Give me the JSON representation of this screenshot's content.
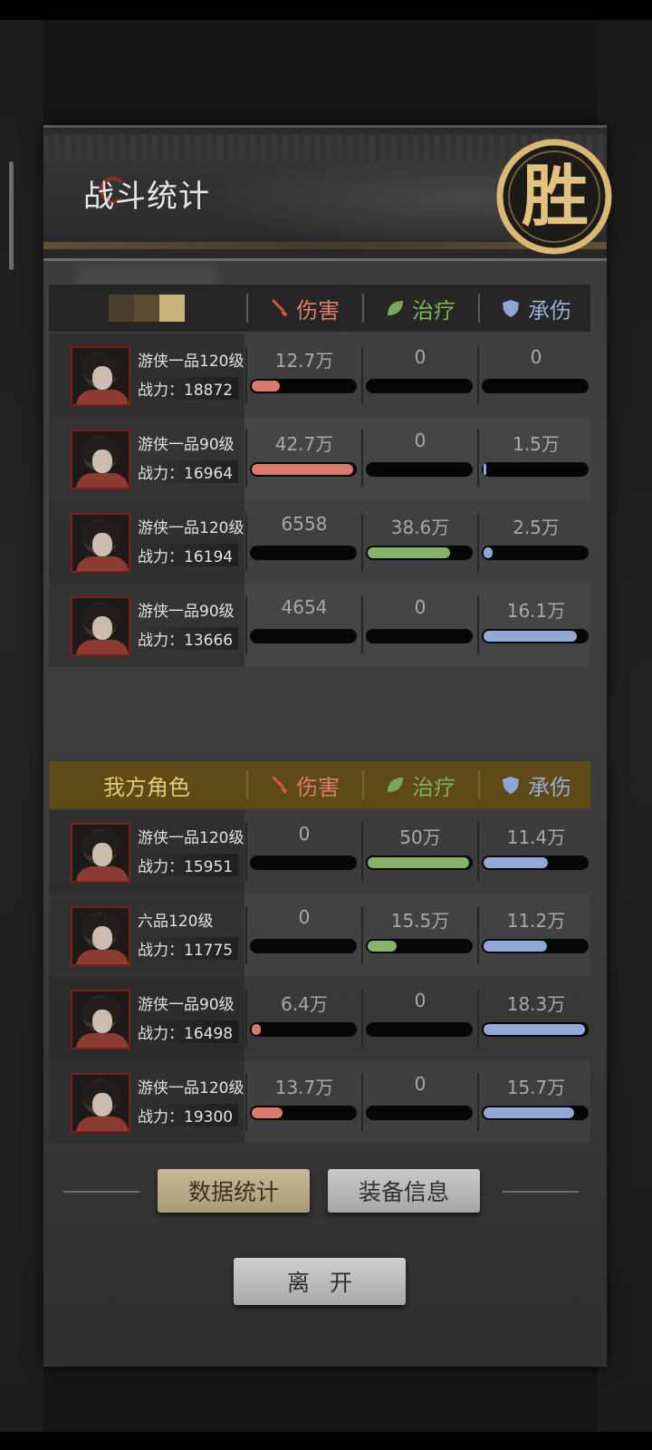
{
  "window": {
    "title": "战斗统计",
    "result_badge": "胜"
  },
  "colors": {
    "damage": "#d97a6c",
    "heal": "#86b26a",
    "tank": "#92a8d6",
    "ally_header": "#5d4a17",
    "badge_gold": "#d8b873"
  },
  "columns": {
    "damage": "伤害",
    "heal": "治疗",
    "tank": "承伤"
  },
  "enemy": {
    "rows": [
      {
        "rank": "游侠一品120级",
        "power": "战力：18872",
        "damage": "12.7万",
        "heal": "0",
        "tank": "0",
        "damage_fill": 0.27,
        "heal_fill": 0,
        "tank_fill": 0
      },
      {
        "rank": "游侠一品90级",
        "power": "战力：16964",
        "damage": "42.7万",
        "heal": "0",
        "tank": "1.5万",
        "damage_fill": 0.98,
        "heal_fill": 0,
        "tank_fill": 0.03
      },
      {
        "rank": "游侠一品120级",
        "power": "战力：16194",
        "damage": "6558",
        "heal": "38.6万",
        "tank": "2.5万",
        "damage_fill": 0,
        "heal_fill": 0.8,
        "tank_fill": 0.09
      },
      {
        "rank": "游侠一品90级",
        "power": "战力：13666",
        "damage": "4654",
        "heal": "0",
        "tank": "16.1万",
        "damage_fill": 0,
        "heal_fill": 0,
        "tank_fill": 0.9
      }
    ]
  },
  "ally": {
    "label": "我方角色",
    "rows": [
      {
        "rank": "游侠一品120级",
        "power": "战力：15951",
        "damage": "0",
        "heal": "50万",
        "tank": "11.4万",
        "damage_fill": 0,
        "heal_fill": 0.98,
        "tank_fill": 0.62
      },
      {
        "rank": "六品120级",
        "power": "战力：11775",
        "damage": "0",
        "heal": "15.5万",
        "tank": "11.2万",
        "damage_fill": 0,
        "heal_fill": 0.28,
        "tank_fill": 0.61
      },
      {
        "rank": "游侠一品90级",
        "power": "战力：16498",
        "damage": "6.4万",
        "heal": "0",
        "tank": "18.3万",
        "damage_fill": 0.09,
        "heal_fill": 0,
        "tank_fill": 0.98
      },
      {
        "rank": "游侠一品120级",
        "power": "战力：19300",
        "damage": "13.7万",
        "heal": "0",
        "tank": "15.7万",
        "damage_fill": 0.3,
        "heal_fill": 0,
        "tank_fill": 0.88
      }
    ]
  },
  "buttons": {
    "stats": "数据统计",
    "equip": "装备信息",
    "leave": "离开"
  }
}
